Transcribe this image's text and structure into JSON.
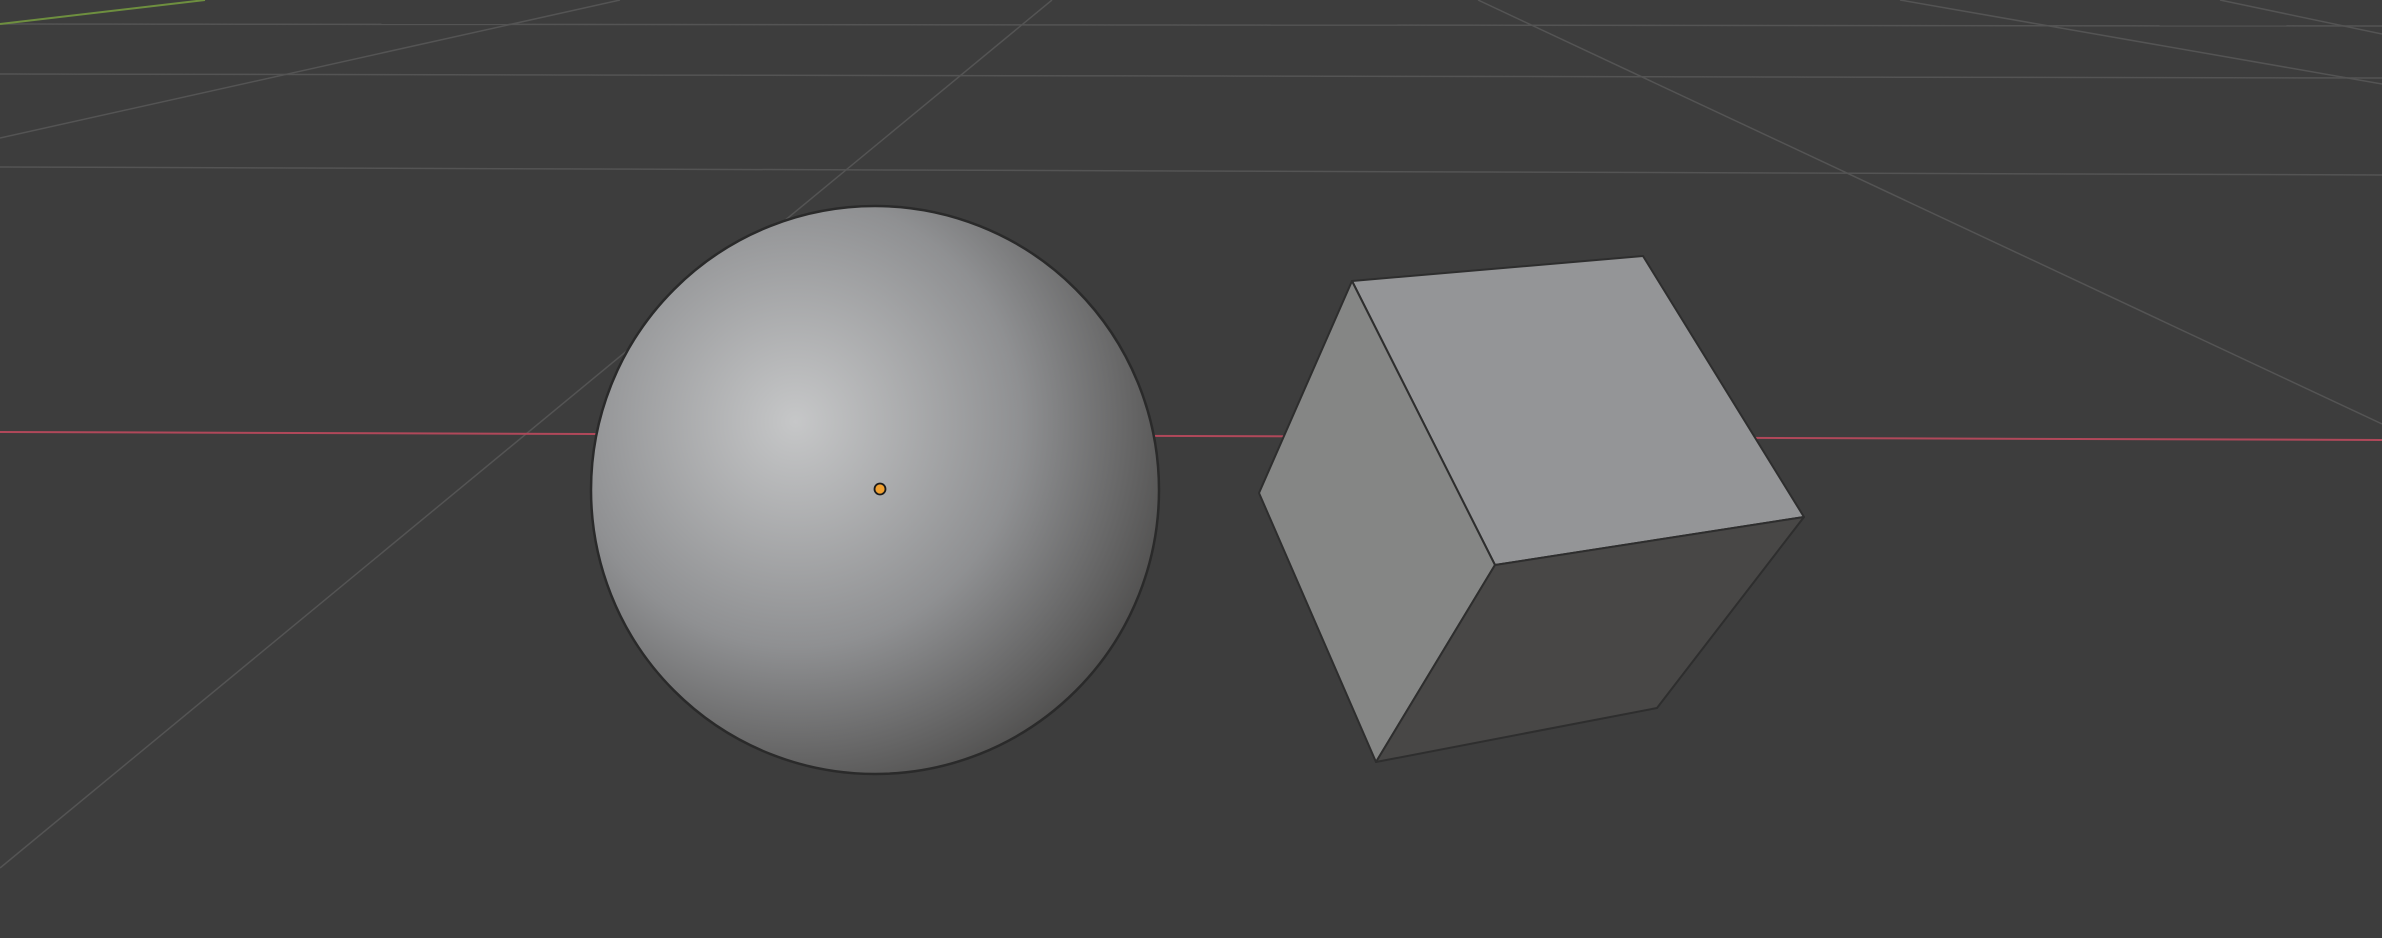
{
  "viewport": {
    "background_color": "#3d3d3d",
    "grid_line_color": "#545454",
    "x_axis_color": "#b0485a",
    "y_axis_color": "#6e8f3f",
    "origin_marker_color": "#f0a030",
    "origin_marker_outline": "#1a1a1a"
  },
  "objects": {
    "sphere": {
      "name": "sphere",
      "highlight_color": "#c6c7c8",
      "base_color": "#8f9092",
      "shadow_color": "#4a4948",
      "outline_color": "#2a2a2a"
    },
    "cube": {
      "name": "cube",
      "top_face_color": "#949597",
      "left_face_color": "#858685",
      "bottom_face_color": "#484746",
      "edge_color": "#2e2e2e"
    }
  }
}
